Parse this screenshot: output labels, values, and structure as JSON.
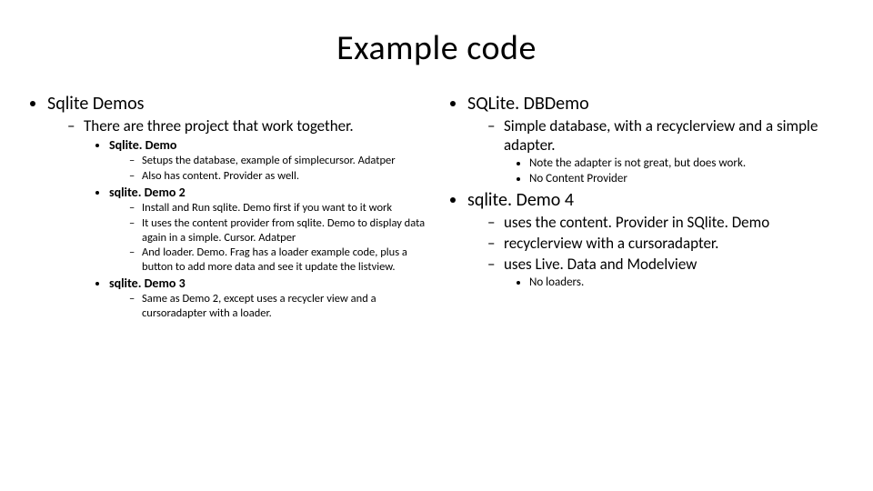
{
  "title": "Example code",
  "left": {
    "heading": "Sqlite Demos",
    "sub": "There are three project that work together.",
    "items": [
      {
        "name": "Sqlite. Demo",
        "details": [
          "Setups the database, example of simplecursor. Adatper",
          "Also has content. Provider as well."
        ]
      },
      {
        "name": "sqlite. Demo 2",
        "details": [
          "Install and Run sqlite. Demo first if you want to it work",
          "It uses the content provider from sqlite. Demo to display data again in a simple. Cursor. Adatper",
          "And loader. Demo. Frag has a loader example code, plus a button to add more data and see it update the listview."
        ]
      },
      {
        "name": "sqlite. Demo 3",
        "details": [
          "Same as Demo 2, except uses a recycler view and a cursoradapter with a loader."
        ]
      }
    ]
  },
  "right": {
    "blocks": [
      {
        "heading": "SQLite. DBDemo",
        "sub": "Simple database, with a recyclerview and a simple adapter.",
        "notes": [
          "Note the adapter is not great, but does work.",
          "No Content Provider"
        ]
      },
      {
        "heading": "sqlite. Demo 4",
        "subs": [
          "uses the content. Provider in SQlite. Demo",
          "recyclerview with a cursoradapter.",
          "uses Live. Data and Modelview"
        ],
        "notes": [
          "No loaders."
        ]
      }
    ]
  }
}
